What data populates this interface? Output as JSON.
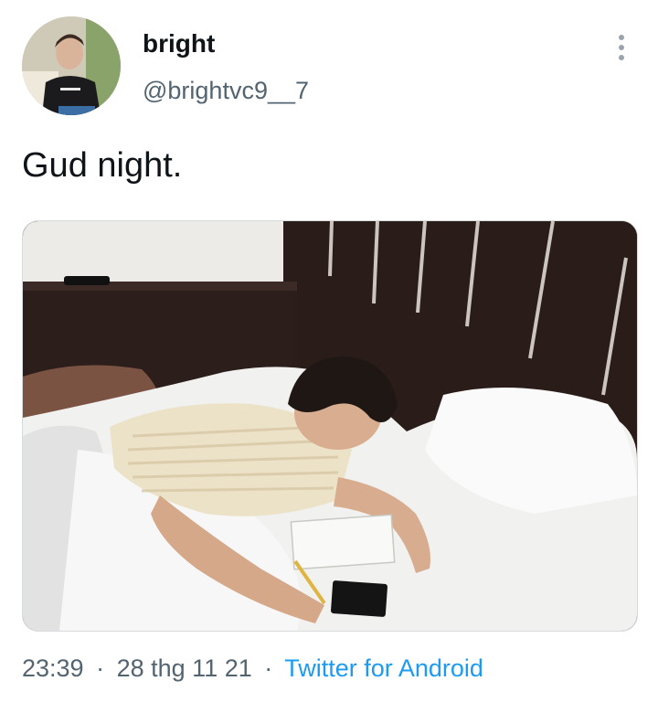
{
  "tweet": {
    "author_name": "bright",
    "author_handle": "@brightvc9__7",
    "text": "Gud night.",
    "time": "23:39",
    "date": "28 thg 11 21",
    "source": "Twitter for Android",
    "separator": "·"
  },
  "icons": {
    "menu": "more-vertical-icon"
  },
  "colors": {
    "name": "#0f1419",
    "secondary": "#536471",
    "link": "#1d9bf0"
  }
}
